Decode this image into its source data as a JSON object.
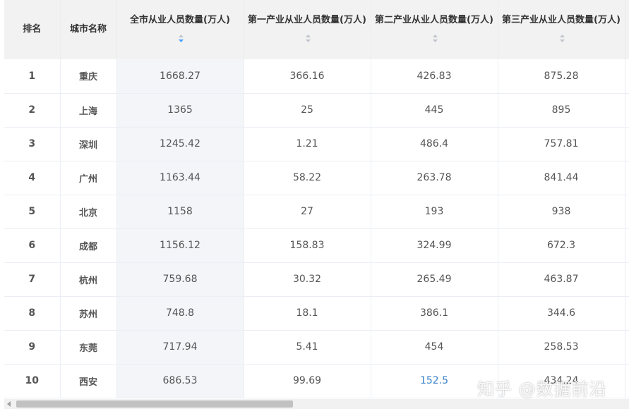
{
  "table": {
    "headers": [
      "排名",
      "城市名称",
      "全市从业人员数量(万人)",
      "第一产业从业人员数量(万人)",
      "第二产业从业人员数量(万人)",
      "第三产业从业人员数量(万人)"
    ],
    "sorted_column": 2,
    "rows": [
      {
        "rank": "1",
        "city": "重庆",
        "total": "1668.27",
        "primary": "366.16",
        "secondary": "426.83",
        "tertiary": "875.28"
      },
      {
        "rank": "2",
        "city": "上海",
        "total": "1365",
        "primary": "25",
        "secondary": "445",
        "tertiary": "895"
      },
      {
        "rank": "3",
        "city": "深圳",
        "total": "1245.42",
        "primary": "1.21",
        "secondary": "486.4",
        "tertiary": "757.81"
      },
      {
        "rank": "4",
        "city": "广州",
        "total": "1163.44",
        "primary": "58.22",
        "secondary": "263.78",
        "tertiary": "841.44"
      },
      {
        "rank": "5",
        "city": "北京",
        "total": "1158",
        "primary": "27",
        "secondary": "193",
        "tertiary": "938"
      },
      {
        "rank": "6",
        "city": "成都",
        "total": "1156.12",
        "primary": "158.83",
        "secondary": "324.99",
        "tertiary": "672.3"
      },
      {
        "rank": "7",
        "city": "杭州",
        "total": "759.68",
        "primary": "30.32",
        "secondary": "265.49",
        "tertiary": "463.87"
      },
      {
        "rank": "8",
        "city": "苏州",
        "total": "748.8",
        "primary": "18.1",
        "secondary": "386.1",
        "tertiary": "344.6"
      },
      {
        "rank": "9",
        "city": "东莞",
        "total": "717.94",
        "primary": "5.41",
        "secondary": "454",
        "tertiary": "258.53"
      },
      {
        "rank": "10",
        "city": "西安",
        "total": "686.53",
        "primary": "99.69",
        "secondary": "152.5",
        "tertiary": "434.24"
      }
    ]
  },
  "watermark": "知乎 @数据前沿",
  "colors": {
    "header_bg": "#f2f2f2",
    "sorted_col_bg": "#f3f5f9",
    "link_blue": "#3a7fc6",
    "sort_active": "#409eff"
  }
}
